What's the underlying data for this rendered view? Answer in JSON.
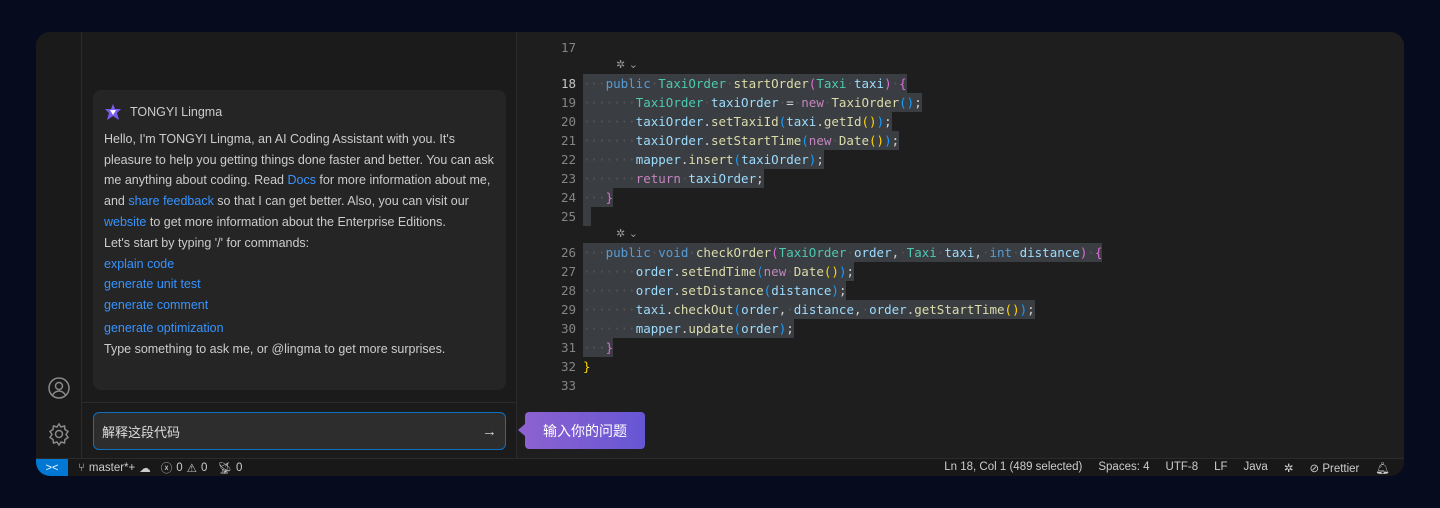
{
  "chat": {
    "assistant_name": "TONGYI Lingma",
    "intro_parts": [
      "Hello, I'm TONGYI Lingma, an AI Coding Assistant with you. It's pleasure to help you getting things done faster and better. You can ask me anything about coding. Read ",
      "Docs",
      " for more information about me, and ",
      "share feedback",
      " so that I can get better. Also, you can visit our ",
      "website",
      " to get more information about the Enterprise Editions."
    ],
    "start_hint": "Let's start by typing '/' for commands:",
    "commands": [
      "explain code",
      "generate unit test",
      "generate comment",
      "generate optimization"
    ],
    "footer_hint": "Type something to ask me, or @lingma to get more surprises.",
    "input_value": "解释这段代码",
    "send_icon": "arrow-right-icon",
    "tooltip": "输入你的问题"
  },
  "editor": {
    "lines": [
      {
        "n": "17",
        "t": []
      },
      {
        "lens": true
      },
      {
        "n": "18",
        "sel": true,
        "t": [
          [
            "ws",
            "···"
          ],
          [
            "kw",
            "public"
          ],
          [
            "ws",
            "·"
          ],
          [
            "ty",
            "TaxiOrder"
          ],
          [
            "ws",
            "·"
          ],
          [
            "fn",
            "startOrder"
          ],
          [
            "b2",
            "("
          ],
          [
            "ty",
            "Taxi"
          ],
          [
            "ws",
            "·"
          ],
          [
            "va",
            "taxi"
          ],
          [
            "b2",
            ")"
          ],
          [
            "ws",
            "·"
          ],
          [
            "b2",
            "{"
          ]
        ]
      },
      {
        "n": "19",
        "sel": true,
        "t": [
          [
            "ws",
            "·······"
          ],
          [
            "ty",
            "TaxiOrder"
          ],
          [
            "ws",
            "·"
          ],
          [
            "va",
            "taxiOrder"
          ],
          [
            "ws",
            "·"
          ],
          [
            "",
            "="
          ],
          [
            "ws",
            "·"
          ],
          [
            "ct",
            "new"
          ],
          [
            "ws",
            "·"
          ],
          [
            "fn",
            "TaxiOrder"
          ],
          [
            "b3",
            "()"
          ],
          [
            "",
            ";"
          ]
        ]
      },
      {
        "n": "20",
        "sel": true,
        "t": [
          [
            "ws",
            "·······"
          ],
          [
            "va",
            "taxiOrder"
          ],
          [
            "",
            "."
          ],
          [
            "fn",
            "setTaxiId"
          ],
          [
            "b3",
            "("
          ],
          [
            "va",
            "taxi"
          ],
          [
            "",
            "."
          ],
          [
            "fn",
            "getId"
          ],
          [
            "b1",
            "()"
          ],
          [
            "b3",
            ")"
          ],
          [
            "",
            ";"
          ]
        ]
      },
      {
        "n": "21",
        "sel": true,
        "t": [
          [
            "ws",
            "·······"
          ],
          [
            "va",
            "taxiOrder"
          ],
          [
            "",
            "."
          ],
          [
            "fn",
            "setStartTime"
          ],
          [
            "b3",
            "("
          ],
          [
            "ct",
            "new"
          ],
          [
            "ws",
            "·"
          ],
          [
            "fn",
            "Date"
          ],
          [
            "b1",
            "()"
          ],
          [
            "b3",
            ")"
          ],
          [
            "",
            ";"
          ]
        ]
      },
      {
        "n": "22",
        "sel": true,
        "t": [
          [
            "ws",
            "·······"
          ],
          [
            "va",
            "mapper"
          ],
          [
            "",
            "."
          ],
          [
            "fn",
            "insert"
          ],
          [
            "b3",
            "("
          ],
          [
            "va",
            "taxiOrder"
          ],
          [
            "b3",
            ")"
          ],
          [
            "",
            ";"
          ]
        ]
      },
      {
        "n": "23",
        "sel": true,
        "t": [
          [
            "ws",
            "·······"
          ],
          [
            "ct",
            "return"
          ],
          [
            "ws",
            "·"
          ],
          [
            "va",
            "taxiOrder"
          ],
          [
            "",
            ";"
          ]
        ]
      },
      {
        "n": "24",
        "sel": true,
        "t": [
          [
            "ws",
            "···"
          ],
          [
            "b2",
            "}"
          ]
        ]
      },
      {
        "n": "25",
        "sel": true,
        "t": [
          [
            "ws",
            " "
          ]
        ]
      },
      {
        "lens": true
      },
      {
        "n": "26",
        "sel": true,
        "t": [
          [
            "ws",
            "···"
          ],
          [
            "kw",
            "public"
          ],
          [
            "ws",
            "·"
          ],
          [
            "kw",
            "void"
          ],
          [
            "ws",
            "·"
          ],
          [
            "fn",
            "checkOrder"
          ],
          [
            "b2",
            "("
          ],
          [
            "ty",
            "TaxiOrder"
          ],
          [
            "ws",
            "·"
          ],
          [
            "va",
            "order"
          ],
          [
            "",
            ","
          ],
          [
            "ws",
            "·"
          ],
          [
            "ty",
            "Taxi"
          ],
          [
            "ws",
            "·"
          ],
          [
            "va",
            "taxi"
          ],
          [
            "",
            ","
          ],
          [
            "ws",
            "·"
          ],
          [
            "kw",
            "int"
          ],
          [
            "ws",
            "·"
          ],
          [
            "va",
            "distance"
          ],
          [
            "b2",
            ")"
          ],
          [
            "ws",
            "·"
          ],
          [
            "b2",
            "{"
          ]
        ]
      },
      {
        "n": "27",
        "sel": true,
        "t": [
          [
            "ws",
            "·······"
          ],
          [
            "va",
            "order"
          ],
          [
            "",
            "."
          ],
          [
            "fn",
            "setEndTime"
          ],
          [
            "b3",
            "("
          ],
          [
            "ct",
            "new"
          ],
          [
            "ws",
            "·"
          ],
          [
            "fn",
            "Date"
          ],
          [
            "b1",
            "()"
          ],
          [
            "b3",
            ")"
          ],
          [
            "",
            ";"
          ]
        ]
      },
      {
        "n": "28",
        "sel": true,
        "t": [
          [
            "ws",
            "·······"
          ],
          [
            "va",
            "order"
          ],
          [
            "",
            "."
          ],
          [
            "fn",
            "setDistance"
          ],
          [
            "b3",
            "("
          ],
          [
            "va",
            "distance"
          ],
          [
            "b3",
            ")"
          ],
          [
            "",
            ";"
          ]
        ]
      },
      {
        "n": "29",
        "sel": true,
        "t": [
          [
            "ws",
            "·······"
          ],
          [
            "va",
            "taxi"
          ],
          [
            "",
            "."
          ],
          [
            "fn",
            "checkOut"
          ],
          [
            "b3",
            "("
          ],
          [
            "va",
            "order"
          ],
          [
            "",
            ","
          ],
          [
            "ws",
            "·"
          ],
          [
            "va",
            "distance"
          ],
          [
            "",
            ","
          ],
          [
            "ws",
            "·"
          ],
          [
            "va",
            "order"
          ],
          [
            "",
            "."
          ],
          [
            "fn",
            "getStartTime"
          ],
          [
            "b1",
            "()"
          ],
          [
            "b3",
            ")"
          ],
          [
            "",
            ";"
          ]
        ]
      },
      {
        "n": "30",
        "sel": true,
        "t": [
          [
            "ws",
            "·······"
          ],
          [
            "va",
            "mapper"
          ],
          [
            "",
            "."
          ],
          [
            "fn",
            "update"
          ],
          [
            "b3",
            "("
          ],
          [
            "va",
            "order"
          ],
          [
            "b3",
            ")"
          ],
          [
            "",
            ";"
          ]
        ]
      },
      {
        "n": "31",
        "sel": true,
        "t": [
          [
            "ws",
            "···"
          ],
          [
            "b2",
            "}"
          ]
        ]
      },
      {
        "n": "32",
        "t": [
          [
            "b1",
            "}"
          ]
        ]
      },
      {
        "n": "33",
        "t": []
      }
    ],
    "current_line": "18",
    "lens_icon": "lingma-icon"
  },
  "status": {
    "branch": "master*+",
    "errors": "0",
    "warnings": "0",
    "ports": "0",
    "cursor": "Ln 18, Col 1 (489 selected)",
    "indent": "Spaces: 4",
    "encoding": "UTF-8",
    "eol": "LF",
    "language": "Java",
    "formatter": "Prettier"
  },
  "colors": {
    "accent": "#0078d4",
    "link": "#3794ff",
    "tooltip": "#7a5cd2"
  }
}
